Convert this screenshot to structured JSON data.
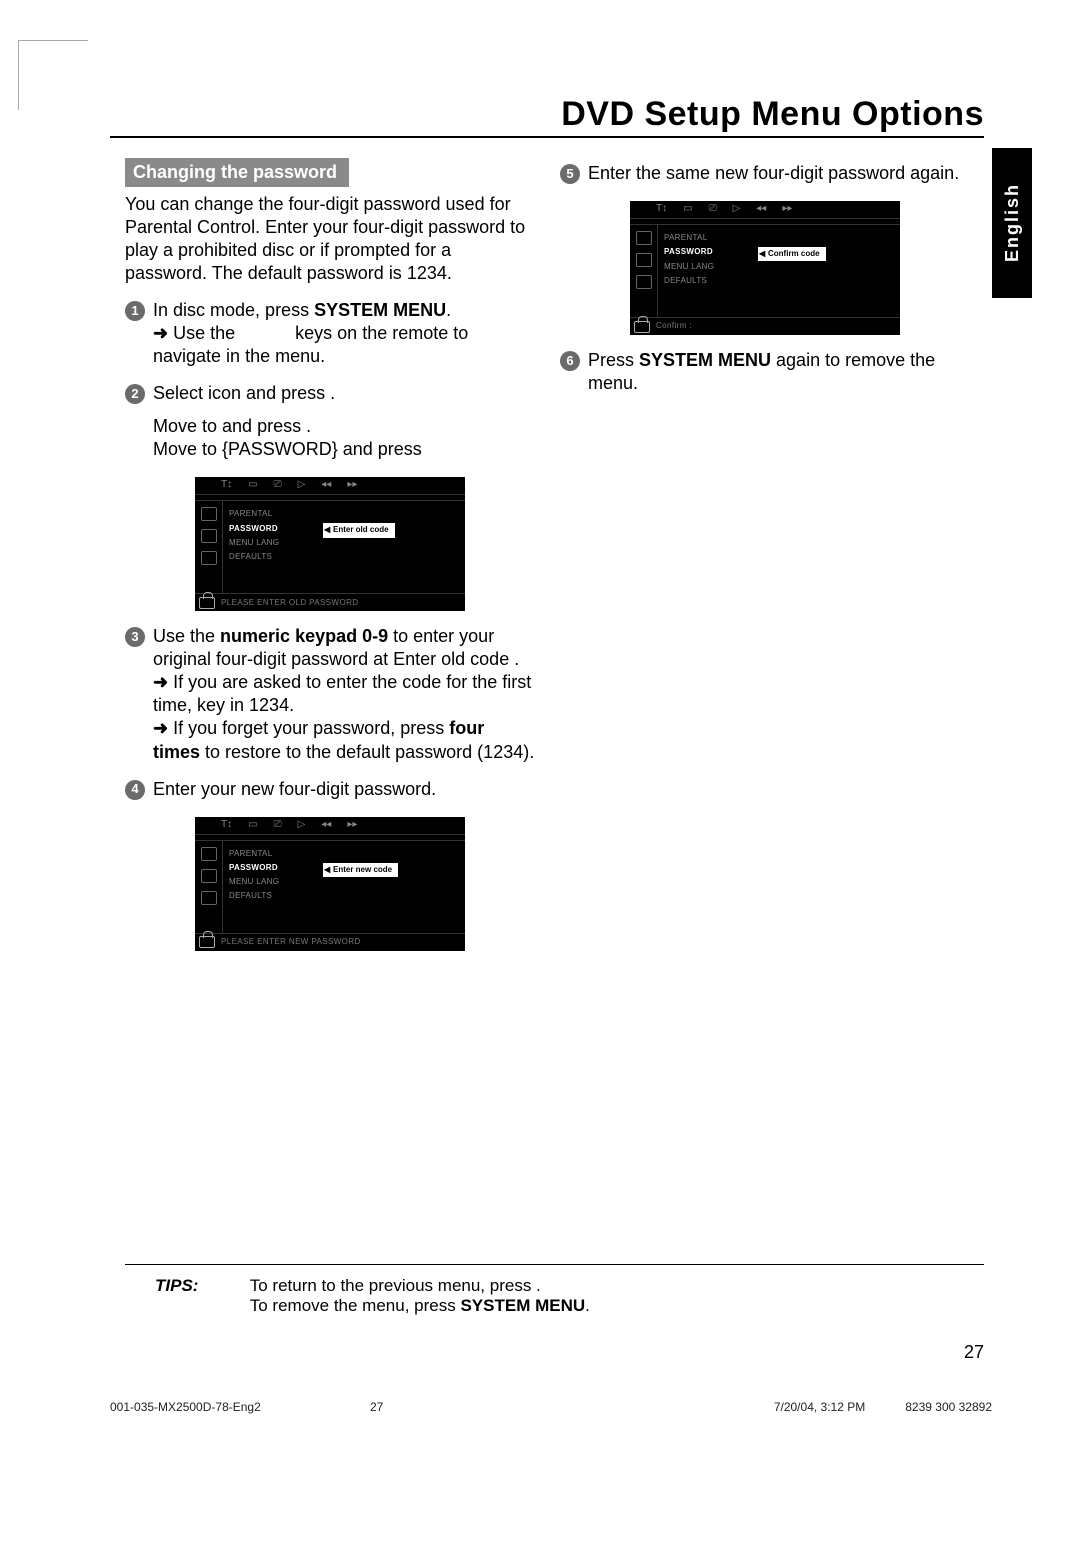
{
  "title": "DVD Setup Menu Options",
  "language_tab": "English",
  "left": {
    "banner": "Changing the password",
    "intro": "You can change the four-digit password used for Parental Control.  Enter your four-digit password to play a prohibited disc or if prompted for a password. The default password is ",
    "intro_code": "1234.",
    "steps": {
      "s1_a": "In disc mode, press ",
      "s1_b": "SYSTEM MENU",
      "s1_c": ".",
      "s1_sub1_a": "Use the",
      "s1_sub1_b": "keys on the remote to navigate in the menu.",
      "s2_a": "Select       icon and press   .",
      "s2_b": "Move to        and press   .",
      "s2_c": "Move to {PASSWORD} and press",
      "s3_a": "Use the ",
      "s3_b": "numeric keypad 0-9",
      "s3_c": " to enter your original four-digit password at ",
      "s3_d": "Enter old code",
      "s3_e": " .",
      "s3_sub1": "If you are asked to enter the code for the first time, key in ",
      "s3_sub1_code": "1234.",
      "s3_sub2_a": "If you forget your password, press",
      "s3_sub2_b": "four times",
      "s3_sub2_c": " to restore to the default password (1234).",
      "s4": "Enter your new four-digit password."
    }
  },
  "right": {
    "steps": {
      "s5": "Enter the same new four-digit password again.",
      "s6_a": "Press ",
      "s6_b": "SYSTEM MENU",
      "s6_c": " again to remove the menu."
    }
  },
  "osd": {
    "items": [
      "PARENTAL",
      "PASSWORD",
      "MENU LANG",
      "DEFAULTS"
    ],
    "chip_old": "Enter old code",
    "chip_new": "Enter new code",
    "chip_confirm": "Confirm code",
    "foot_old": "PLEASE ENTER OLD PASSWORD",
    "foot_new": "PLEASE ENTER NEW PASSWORD",
    "foot_confirm": "Confirm :",
    "topicons": [
      "T↕",
      "▭",
      "⎚",
      "▷",
      "◂◂",
      "▸▸"
    ]
  },
  "tips": {
    "label": "TIPS:",
    "line1": "To return to the previous menu, press   .",
    "line2_a": "To remove the menu, press ",
    "line2_b": "SYSTEM MENU",
    "line2_c": "."
  },
  "page_number": "27",
  "footer": {
    "left": "001-035-MX2500D-78-Eng2",
    "mid": "27",
    "date": "7/20/04, 3:12 PM",
    "code": "8239 300 32892"
  }
}
